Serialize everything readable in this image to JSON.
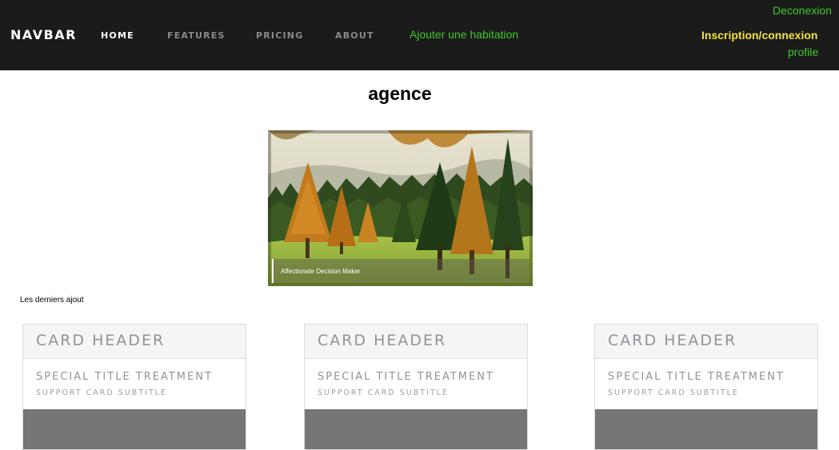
{
  "navbar": {
    "brand": "NAVBAR",
    "links": {
      "home": "HOME",
      "features": "FEATURES",
      "pricing": "PRICING",
      "about": "ABOUT"
    },
    "add_listing": "Ajouter une habitation",
    "login_register": "Inscription/connexion",
    "logout": "Deconexion",
    "profile": "profile",
    "colors": {
      "background": "#1b1b1b",
      "green": "#3ec82a",
      "yellow": "#f2e33b",
      "active": "#ffffff",
      "inactive": "#8a8a8a"
    }
  },
  "main": {
    "title": "agence",
    "hero": {
      "caption": "Affectionate Decision Maker"
    },
    "latest_label": "Les derniers ajout"
  },
  "cards": [
    {
      "header": "CARD HEADER",
      "title": "SPECIAL TITLE TREATMENT",
      "subtitle": "SUPPORT CARD SUBTITLE"
    },
    {
      "header": "CARD HEADER",
      "title": "SPECIAL TITLE TREATMENT",
      "subtitle": "SUPPORT CARD SUBTITLE"
    },
    {
      "header": "CARD HEADER",
      "title": "SPECIAL TITLE TREATMENT",
      "subtitle": "SUPPORT CARD SUBTITLE"
    }
  ]
}
